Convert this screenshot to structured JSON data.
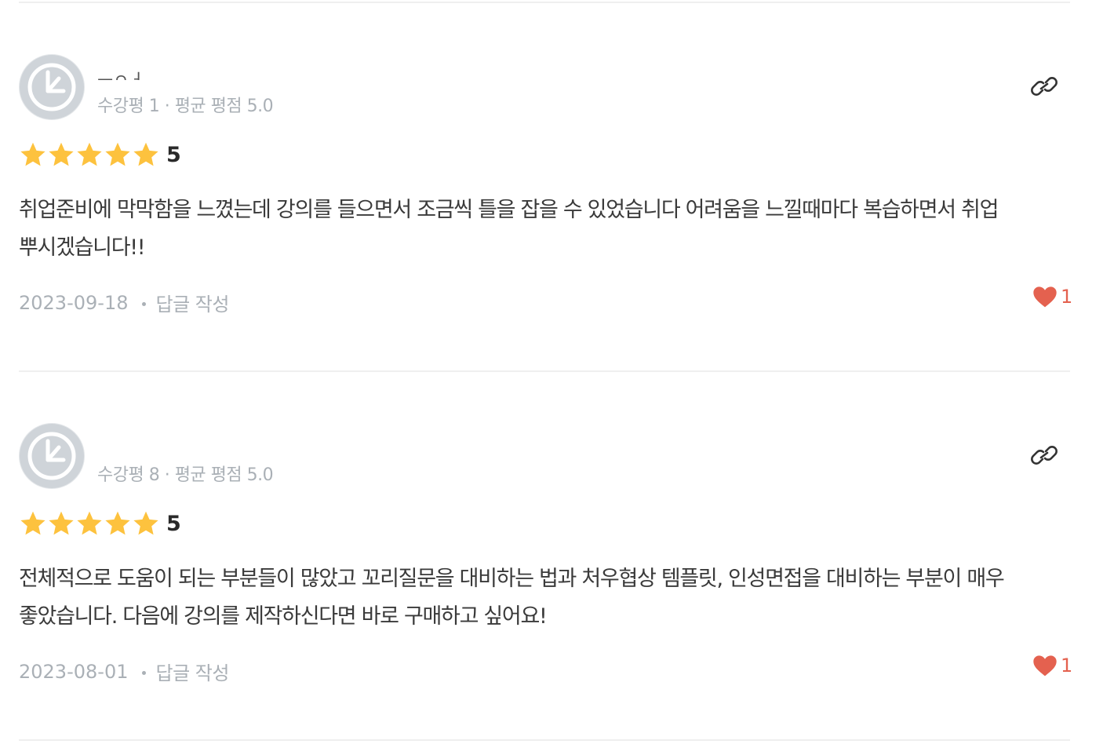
{
  "reviews": [
    {
      "user_name": "ㅡㅇㅓ",
      "stats": "수강평 1 · 평균 평점 5.0",
      "rating": "5",
      "stars": 5,
      "body": "취업준비에 막막함을 느꼈는데 강의를 들으면서 조금씩 틀을 잡을 수 있었습니다 어려움을 느낄때마다 복습하면서 취업 뿌시겠습니다!!",
      "date": "2023-09-18",
      "reply_label": "답글 작성",
      "likes": "1"
    },
    {
      "user_name": "",
      "stats": "수강평 8 · 평균 평점 5.0",
      "rating": "5",
      "stars": 5,
      "body": "전체적으로 도움이 되는 부분들이 많았고 꼬리질문을 대비하는 법과 처우협상 템플릿, 인성면접을 대비하는 부분이 매우 좋았습니다. 다음에 강의를 제작하신다면 바로 구매하고 싶어요!",
      "date": "2023-08-01",
      "reply_label": "답글 작성",
      "likes": "1"
    }
  ],
  "colors": {
    "star": "#fdc23e",
    "heart": "#e4614f",
    "muted_text": "#aab0b6",
    "avatar_bg": "#cfd4d9"
  },
  "icons": {
    "link": "link-icon",
    "heart": "heart-icon",
    "star": "star-icon",
    "avatar": "avatar-placeholder-icon"
  }
}
